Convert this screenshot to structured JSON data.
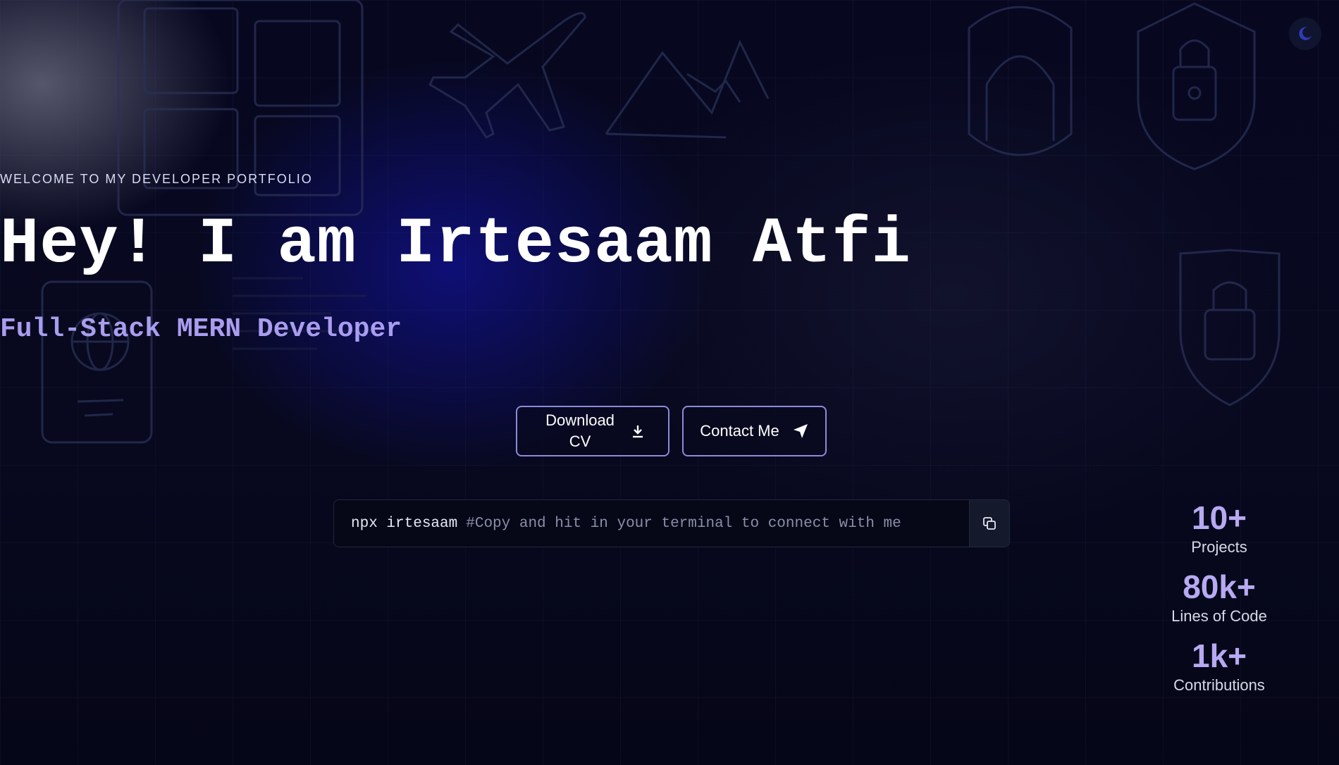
{
  "theme_toggle": {
    "icon": "moon-icon"
  },
  "hero": {
    "welcome": "WELCOME TO MY DEVELOPER PORTFOLIO",
    "title": "Hey! I am Irtesaam Atfi",
    "subtitle": "Full-Stack MERN Developer"
  },
  "buttons": {
    "download_cv": "Download CV",
    "download_icon": "download-icon",
    "contact": "Contact Me",
    "contact_icon": "send-icon"
  },
  "terminal": {
    "command": "npx irtesaam",
    "comment": "#Copy and hit in your terminal to connect with me",
    "copy_icon": "copy-icon"
  },
  "stats": [
    {
      "value": "10+",
      "label": "Projects"
    },
    {
      "value": "80k+",
      "label": "Lines of Code"
    },
    {
      "value": "1k+",
      "label": "Contributions"
    }
  ],
  "colors": {
    "background": "#06071c",
    "accent": "#a99df0",
    "button_border": "#8e8ad8",
    "toggle_icon": "#2d3bb8"
  }
}
